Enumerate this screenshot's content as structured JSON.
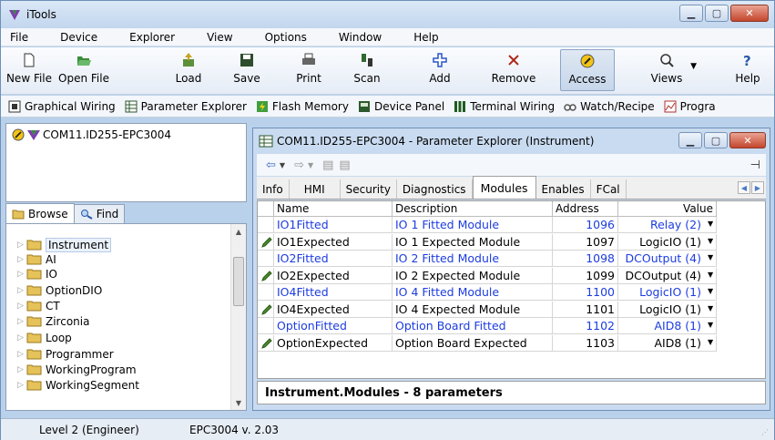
{
  "app": {
    "title": "iTools"
  },
  "menu": [
    "File",
    "Device",
    "Explorer",
    "View",
    "Options",
    "Window",
    "Help"
  ],
  "toolbar": [
    {
      "label": "New File",
      "icon": "new-file-icon"
    },
    {
      "label": "Open File",
      "icon": "open-file-icon"
    },
    {
      "label": "Load",
      "icon": "load-icon"
    },
    {
      "label": "Save",
      "icon": "save-icon"
    },
    {
      "label": "Print",
      "icon": "print-icon"
    },
    {
      "label": "Scan",
      "icon": "scan-icon"
    },
    {
      "label": "Add",
      "icon": "add-icon"
    },
    {
      "label": "Remove",
      "icon": "remove-icon"
    },
    {
      "label": "Access",
      "icon": "access-icon"
    },
    {
      "label": "Views",
      "icon": "views-icon"
    },
    {
      "label": "Help",
      "icon": "help-icon"
    }
  ],
  "panels": [
    {
      "label": "Graphical Wiring"
    },
    {
      "label": "Parameter Explorer"
    },
    {
      "label": "Flash Memory"
    },
    {
      "label": "Device Panel"
    },
    {
      "label": "Terminal Wiring"
    },
    {
      "label": "Watch/Recipe"
    },
    {
      "label": "Progra"
    }
  ],
  "device": {
    "name": "COM11.ID255-EPC3004"
  },
  "browse": {
    "tab_browse": "Browse",
    "tab_find": "Find"
  },
  "tree": [
    "Instrument",
    "AI",
    "IO",
    "OptionDIO",
    "CT",
    "Zirconia",
    "Loop",
    "Programmer",
    "WorkingProgram",
    "WorkingSegment"
  ],
  "child": {
    "title": "COM11.ID255-EPC3004 - Parameter Explorer (Instrument)",
    "tabs": [
      "Info",
      "HMI",
      "Security",
      "Diagnostics",
      "Modules",
      "Enables",
      "FCal"
    ],
    "active_tab": "Modules",
    "columns": {
      "name": "Name",
      "description": "Description",
      "address": "Address",
      "value": "Value"
    },
    "rows": [
      {
        "name": "IO1Fitted",
        "description": "IO 1 Fitted Module",
        "address": "1096",
        "value": "Relay (2)",
        "readonly": true
      },
      {
        "name": "IO1Expected",
        "description": "IO 1 Expected Module",
        "address": "1097",
        "value": "LogicIO (1)",
        "readonly": false
      },
      {
        "name": "IO2Fitted",
        "description": "IO 2 Fitted Module",
        "address": "1098",
        "value": "DCOutput (4)",
        "readonly": true
      },
      {
        "name": "IO2Expected",
        "description": "IO 2 Expected Module",
        "address": "1099",
        "value": "DCOutput (4)",
        "readonly": false
      },
      {
        "name": "IO4Fitted",
        "description": "IO 4 Fitted Module",
        "address": "1100",
        "value": "LogicIO (1)",
        "readonly": true
      },
      {
        "name": "IO4Expected",
        "description": "IO 4 Expected Module",
        "address": "1101",
        "value": "LogicIO (1)",
        "readonly": false
      },
      {
        "name": "OptionFitted",
        "description": "Option Board Fitted",
        "address": "1102",
        "value": "AID8 (1)",
        "readonly": true
      },
      {
        "name": "OptionExpected",
        "description": "Option Board Expected",
        "address": "1103",
        "value": "AID8 (1)",
        "readonly": false
      }
    ],
    "status": "Instrument.Modules  -  8 parameters"
  },
  "statusbar": {
    "level": "Level 2 (Engineer)",
    "version": "EPC3004 v. 2.03"
  },
  "colors": {
    "readonly_text": "#1c3ce0",
    "frame": "#b9d1ea"
  }
}
